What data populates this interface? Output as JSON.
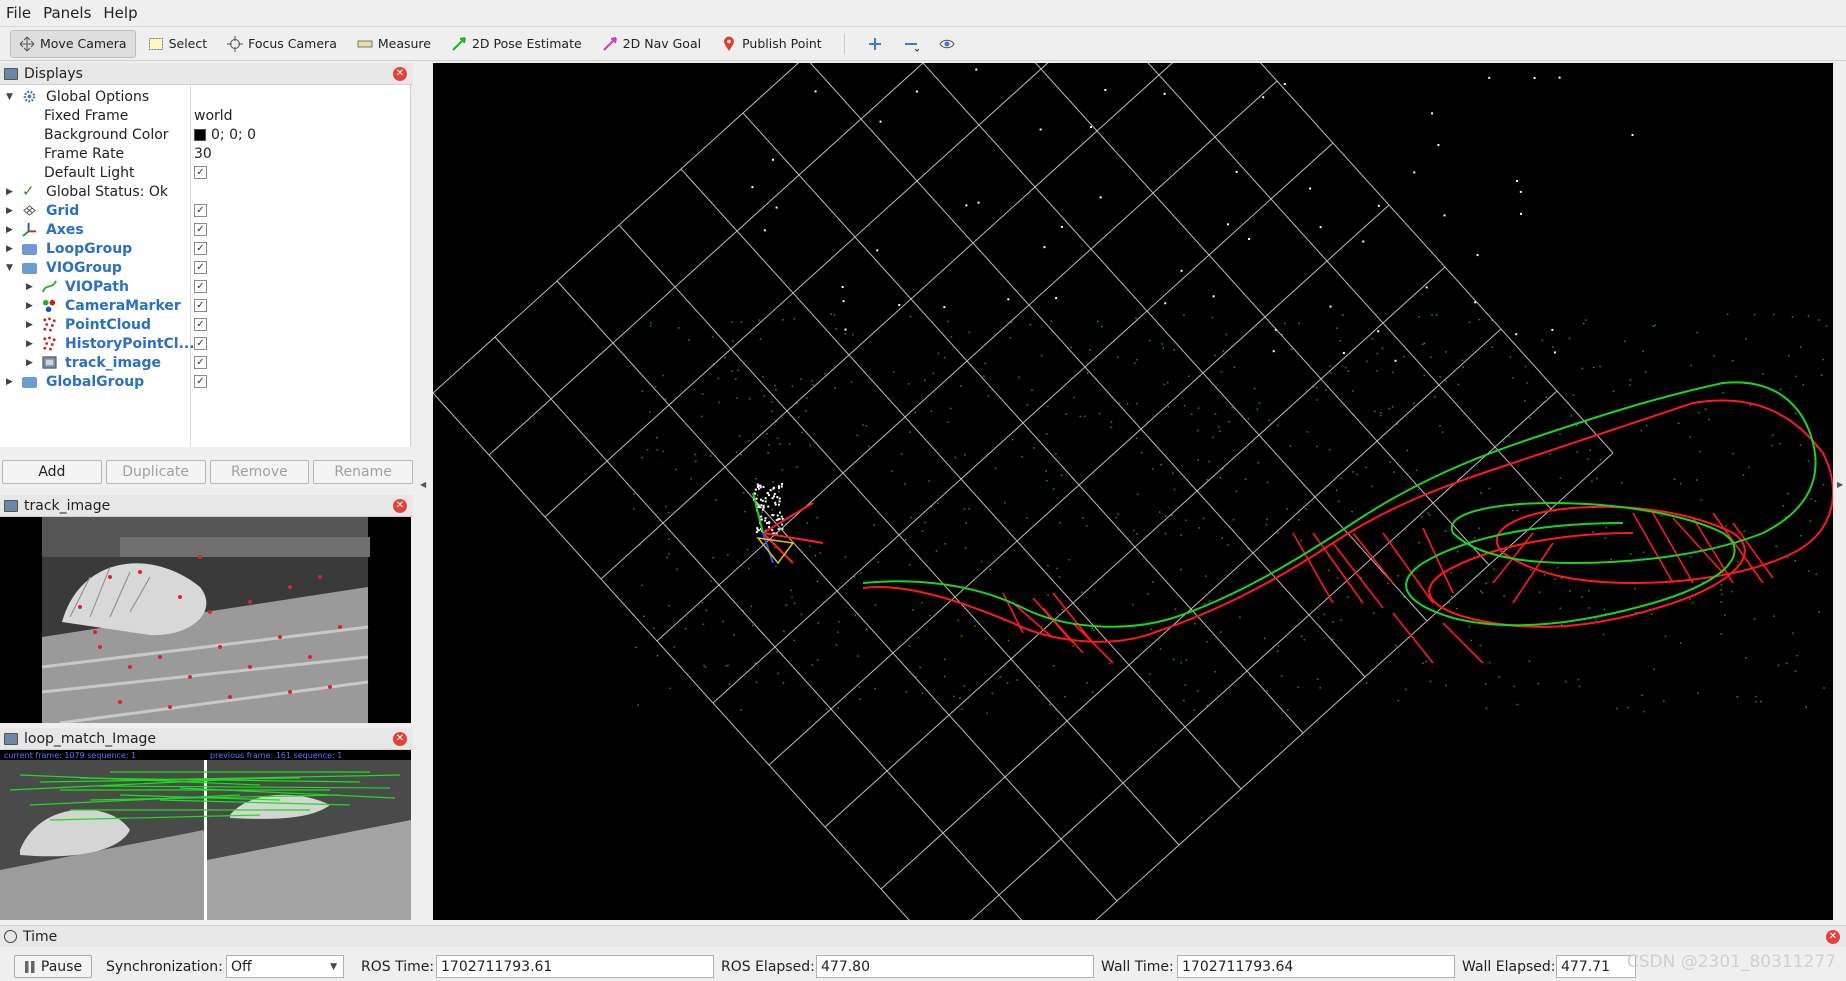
{
  "menu": {
    "file": "File",
    "panels": "Panels",
    "help": "Help"
  },
  "toolbar": {
    "move_camera": "Move Camera",
    "select": "Select",
    "focus_camera": "Focus Camera",
    "measure": "Measure",
    "pose_estimate": "2D Pose Estimate",
    "nav_goal": "2D Nav Goal",
    "publish_point": "Publish Point"
  },
  "displays": {
    "title": "Displays",
    "global_options": "Global Options",
    "fixed_frame_label": "Fixed Frame",
    "fixed_frame_value": "world",
    "background_color_label": "Background Color",
    "background_color_value": "0; 0; 0",
    "frame_rate_label": "Frame Rate",
    "frame_rate_value": "30",
    "default_light_label": "Default Light",
    "global_status": "Global Status: Ok",
    "grid": "Grid",
    "axes": "Axes",
    "loop_group": "LoopGroup",
    "vio_group": "VIOGroup",
    "vio_path": "VIOPath",
    "camera_marker": "CameraMarker",
    "point_cloud": "PointCloud",
    "history_point_cloud": "HistoryPointCl...",
    "track_image": "track_image",
    "global_group": "GlobalGroup"
  },
  "buttons": {
    "add": "Add",
    "duplicate": "Duplicate",
    "remove": "Remove",
    "rename": "Rename"
  },
  "track_panel": {
    "title": "track_image"
  },
  "loop_panel": {
    "title": "loop_match_Image",
    "current_caption": "current frame: 1079   sequence: 1",
    "previous_caption": "previous frame: 161   sequence: 1"
  },
  "time": {
    "title": "Time",
    "pause": "Pause",
    "sync_label": "Synchronization:",
    "sync_value": "Off",
    "ros_time_label": "ROS Time:",
    "ros_time": "1702711793.61",
    "ros_elapsed_label": "ROS Elapsed:",
    "ros_elapsed": "477.80",
    "wall_time_label": "Wall Time:",
    "wall_time": "1702711793.64",
    "wall_elapsed_label": "Wall Elapsed:",
    "wall_elapsed": "477.71"
  },
  "watermark": "CSDN @2301_80311277",
  "colors": {
    "path_green": "#1fd21f",
    "path_red": "#ff1a1a",
    "folder_blue": "#6c9bd2",
    "link_blue": "#2a6fc8"
  }
}
